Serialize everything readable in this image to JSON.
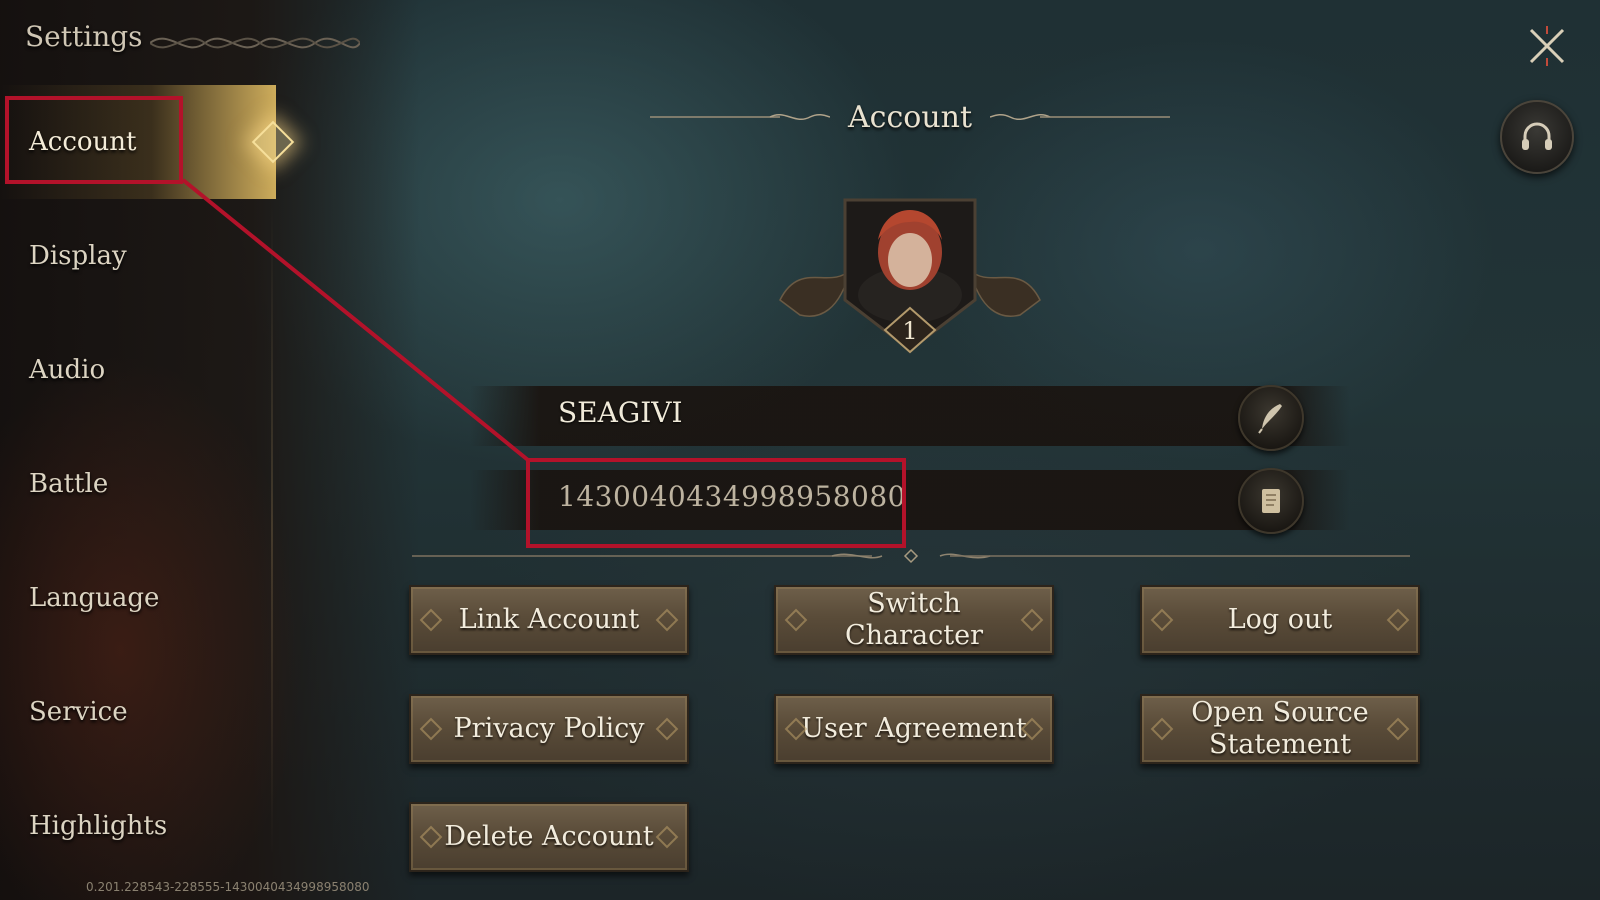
{
  "header": {
    "title": "Settings"
  },
  "sidebar": {
    "items": [
      {
        "label": "Account",
        "active": true
      },
      {
        "label": "Display",
        "active": false
      },
      {
        "label": "Audio",
        "active": false
      },
      {
        "label": "Battle",
        "active": false
      },
      {
        "label": "Language",
        "active": false
      },
      {
        "label": "Service",
        "active": false
      },
      {
        "label": "Highlights",
        "active": false
      }
    ]
  },
  "main": {
    "section_title": "Account",
    "avatar": {
      "level": "1"
    },
    "player_name": "SEAGIVI",
    "player_id": "1430040434998958080",
    "edit_icon": "quill-icon",
    "copy_icon": "scroll-icon",
    "buttons": {
      "link_account": "Link Account",
      "switch_character": "Switch Character",
      "log_out": "Log out",
      "privacy_policy": "Privacy Policy",
      "user_agreement": "User Agreement",
      "open_source": "Open Source Statement",
      "delete_account": "Delete Account"
    }
  },
  "top_right": {
    "close_icon": "close-x-icon",
    "support_icon": "headset-icon"
  },
  "footer": {
    "version": "0.201.228543-228555-1430040434998958080"
  },
  "colors": {
    "highlight": "#b3122a",
    "accent_gold": "#d7b45f",
    "button_face": "#5a4c39"
  }
}
